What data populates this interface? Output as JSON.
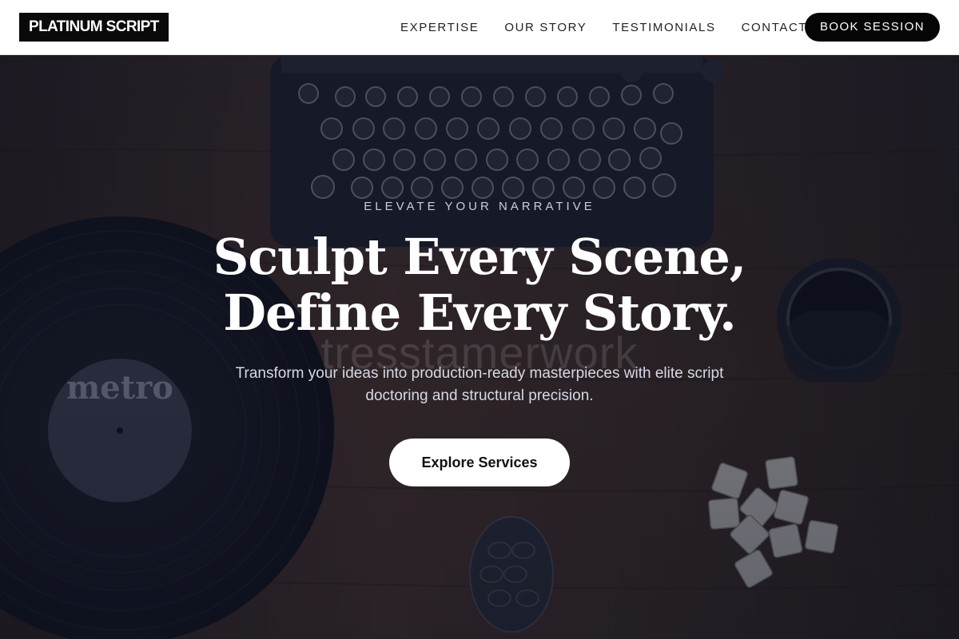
{
  "brand": {
    "logo_text": "PLATINUM SCRIPT"
  },
  "nav": {
    "items": [
      {
        "label": "EXPERTISE"
      },
      {
        "label": "OUR STORY"
      },
      {
        "label": "TESTIMONIALS"
      },
      {
        "label": "CONTACT"
      }
    ],
    "cta_label": "BOOK SESSION"
  },
  "hero": {
    "eyebrow": "ELEVATE YOUR NARRATIVE",
    "headline_line1": "Sculpt Every Scene,",
    "headline_line2": "Define Every Story.",
    "subtitle": "Transform your ideas into production-ready masterpieces with elite script doctoring and structural precision.",
    "watermark": "tresstamerwork",
    "cta_label": "Explore Services",
    "record_label_text": "metro"
  },
  "colors": {
    "header_bg": "#ffffff",
    "logo_bg": "#0a0a0a",
    "button_dark": "#050505",
    "hero_overlay": "#101428",
    "cta_bg": "#ffffff"
  }
}
